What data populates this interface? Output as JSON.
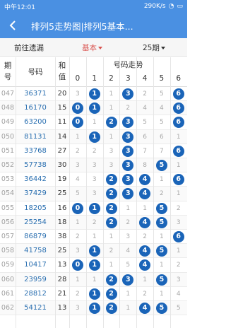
{
  "status": {
    "time": "中午12:01",
    "speed": "290K/s"
  },
  "appbar": {
    "title": "排列5走势图|排列5基本..."
  },
  "filters": {
    "left": "前往遗漏",
    "center": "基本",
    "right": "25期"
  },
  "colors": {
    "primary": "#4a90e2",
    "ball": "#1a64b8",
    "num": "#2a6fb0"
  },
  "header": {
    "period": "期号",
    "number": "号码",
    "sum": "和值",
    "trend": "号码走势",
    "digits": [
      "0",
      "1",
      "2",
      "3",
      "4",
      "5",
      "6"
    ]
  },
  "rows": [
    {
      "period": "047",
      "number": "36371",
      "sum": "20",
      "cells": [
        "3",
        "1",
        "1",
        "3",
        "2",
        "5",
        "6"
      ],
      "hit": [
        1,
        3,
        6
      ]
    },
    {
      "period": "048",
      "number": "16170",
      "sum": "15",
      "cells": [
        "0",
        "1",
        "1",
        "2",
        "4",
        "4",
        "6"
      ],
      "hit": [
        0,
        1,
        6
      ]
    },
    {
      "period": "049",
      "number": "63200",
      "sum": "11",
      "cells": [
        "0",
        "1",
        "2",
        "3",
        "5",
        "5",
        "6"
      ],
      "hit": [
        0,
        2,
        3,
        6
      ]
    },
    {
      "period": "050",
      "number": "81131",
      "sum": "14",
      "cells": [
        "1",
        "1",
        "1",
        "3",
        "6",
        "6",
        "1"
      ],
      "hit": [
        1,
        3
      ]
    },
    {
      "period": "051",
      "number": "33768",
      "sum": "27",
      "cells": [
        "2",
        "2",
        "3",
        "3",
        "7",
        "7",
        "6"
      ],
      "hit": [
        3,
        6
      ]
    },
    {
      "period": "052",
      "number": "57738",
      "sum": "30",
      "cells": [
        "3",
        "3",
        "3",
        "3",
        "8",
        "5",
        "1"
      ],
      "hit": [
        3,
        5
      ]
    },
    {
      "period": "053",
      "number": "36442",
      "sum": "19",
      "cells": [
        "4",
        "3",
        "2",
        "3",
        "4",
        "1",
        "6"
      ],
      "hit": [
        2,
        3,
        4,
        6
      ]
    },
    {
      "period": "054",
      "number": "37429",
      "sum": "25",
      "cells": [
        "5",
        "3",
        "2",
        "3",
        "4",
        "2",
        "1"
      ],
      "hit": [
        2,
        3,
        4
      ]
    },
    {
      "period": "055",
      "number": "18205",
      "sum": "16",
      "cells": [
        "0",
        "1",
        "2",
        "1",
        "1",
        "5",
        "2"
      ],
      "hit": [
        0,
        1,
        2,
        5
      ]
    },
    {
      "period": "056",
      "number": "25254",
      "sum": "18",
      "cells": [
        "1",
        "2",
        "2",
        "2",
        "4",
        "5",
        "3"
      ],
      "hit": [
        2,
        4,
        5
      ]
    },
    {
      "period": "057",
      "number": "86879",
      "sum": "38",
      "cells": [
        "2",
        "1",
        "1",
        "3",
        "2",
        "1",
        "6"
      ],
      "hit": [
        6
      ]
    },
    {
      "period": "058",
      "number": "41758",
      "sum": "25",
      "cells": [
        "3",
        "1",
        "2",
        "4",
        "4",
        "5",
        "1"
      ],
      "hit": [
        1,
        4,
        5
      ]
    },
    {
      "period": "059",
      "number": "10417",
      "sum": "13",
      "cells": [
        "0",
        "1",
        "1",
        "5",
        "4",
        "1",
        "2"
      ],
      "hit": [
        0,
        1,
        4
      ]
    },
    {
      "period": "060",
      "number": "23959",
      "sum": "28",
      "cells": [
        "1",
        "1",
        "2",
        "3",
        "1",
        "5",
        "3"
      ],
      "hit": [
        2,
        3,
        5
      ]
    },
    {
      "period": "061",
      "number": "28812",
      "sum": "21",
      "cells": [
        "2",
        "1",
        "2",
        "1",
        "2",
        "1",
        "4"
      ],
      "hit": [
        1,
        2
      ]
    },
    {
      "period": "062",
      "number": "54121",
      "sum": "13",
      "cells": [
        "3",
        "1",
        "2",
        "1",
        "4",
        "5",
        "5"
      ],
      "hit": [
        1,
        2,
        4,
        5
      ]
    }
  ]
}
